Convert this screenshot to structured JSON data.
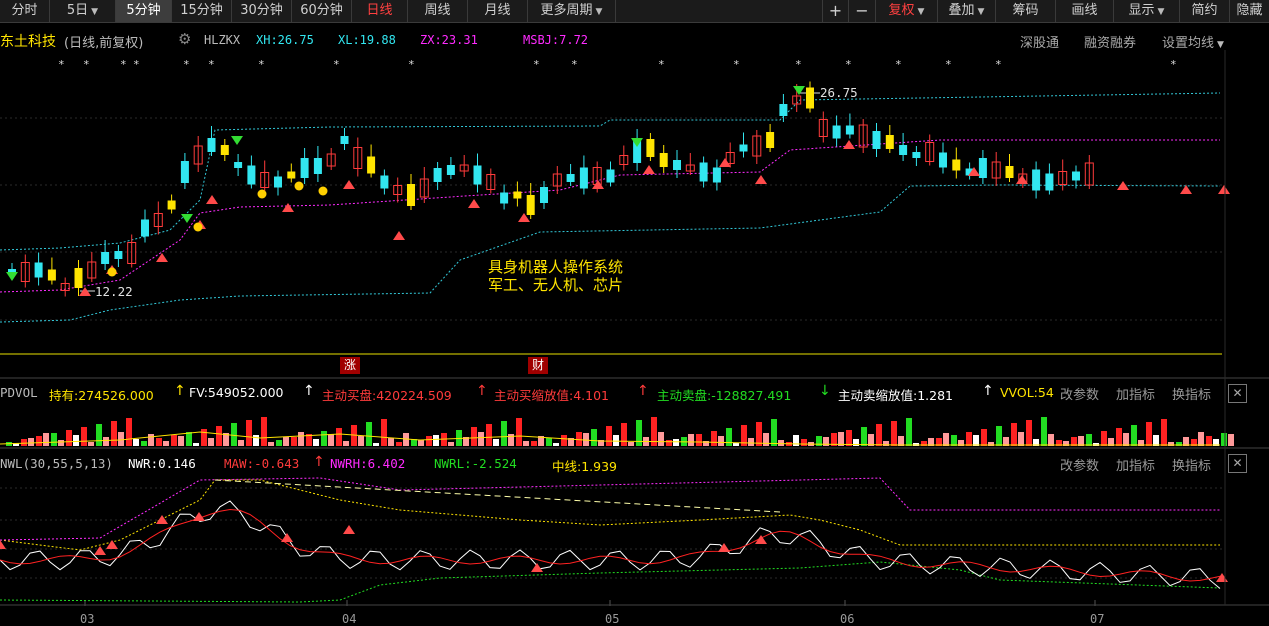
{
  "toolbar": {
    "periods": [
      "分时",
      "5日",
      "5分钟",
      "15分钟",
      "30分钟",
      "60分钟",
      "日线",
      "周线",
      "月线",
      "更多周期"
    ],
    "active_period": "5分钟",
    "selected_period": "日线",
    "plus": "+",
    "minus": "−",
    "fuquan": "复权",
    "diejia": "叠加",
    "chouma": "筹码",
    "huaxian": "画线",
    "xianshi": "显示",
    "jianyue": "简约",
    "yincang": "隐藏"
  },
  "title": {
    "stock_name": "东土科技",
    "mode": "(日线,前复权)",
    "indicator_name": "HLZKX",
    "xh": "XH:26.75",
    "xl": "XL:19.88",
    "zx": "ZX:23.31",
    "msbj": "MSBJ:7.72",
    "links": [
      "深股通",
      "融资融券",
      "设置均线"
    ]
  },
  "main_chart": {
    "high_label": "26.75",
    "low_label": "12.22",
    "annotation_line1": "具身机器人操作系统",
    "annotation_line2": "军工、无人机、芯片",
    "event_markers": [
      "涨",
      "财"
    ]
  },
  "vol_panel": {
    "name": "PDVOL",
    "chiyou": "持有:274526.000",
    "fv": "FV:549052.000",
    "zdmp": "主动买盘:420224.509",
    "zdmsf": "主动买缩放值:4.101",
    "zdmaip": "主动卖盘:-128827.491",
    "zdmaisf": "主动卖缩放值:1.281",
    "vvol": "VVOL:54",
    "buttons": [
      "改参数",
      "加指标",
      "换指标"
    ]
  },
  "nwl_panel": {
    "name": "NWL(30,55,5,13)",
    "nwr": "NWR:0.146",
    "maw": "MAW:-0.643",
    "nwrh": "NWRH:6.402",
    "nwrl": "NWRL:-2.524",
    "zhongxian": "中线:1.939",
    "buttons": [
      "改参数",
      "加指标",
      "换指标"
    ]
  },
  "x_axis": [
    "03",
    "04",
    "05",
    "06",
    "07"
  ],
  "colors": {
    "up": "#ff3b3b",
    "down": "#32e6f0",
    "yellow": "#ffe400",
    "band": "#ff2bff",
    "green": "#22dd22"
  }
}
